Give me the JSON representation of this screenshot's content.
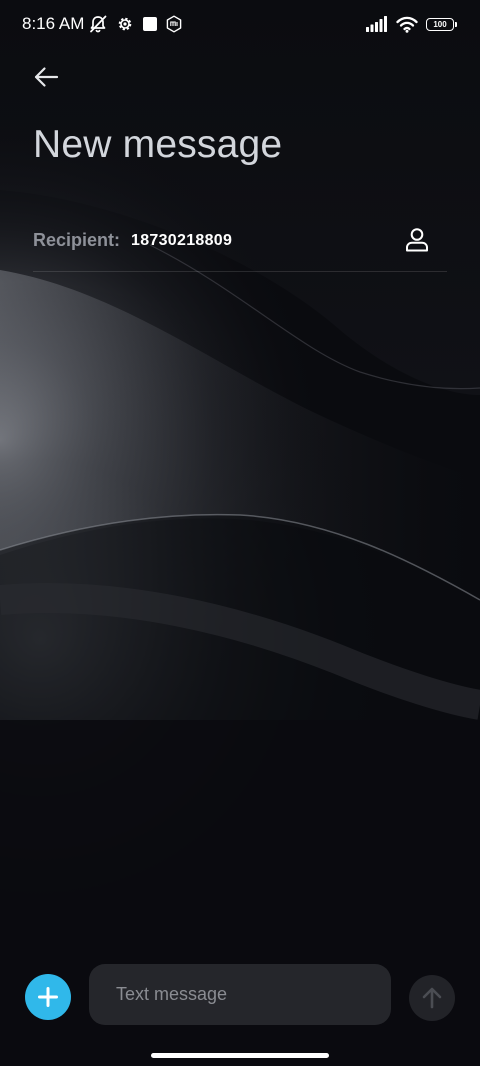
{
  "status_bar": {
    "time": "8:16 AM",
    "battery_level": "100",
    "icons": [
      "mute-notifications-icon",
      "settings-icon",
      "square-notification-icon",
      "mi-icon",
      "signal-icon",
      "wifi-icon",
      "battery-icon"
    ]
  },
  "header": {
    "back_icon": "arrow-left-icon",
    "title": "New message"
  },
  "recipient": {
    "label": "Recipient:",
    "value": "18730218809",
    "contact_icon": "person-icon"
  },
  "composer": {
    "attach_icon": "plus-icon",
    "placeholder": "Text message",
    "value": "",
    "send_icon": "arrow-up-icon"
  },
  "colors": {
    "accent": "#30b8ea",
    "background": "#0a0b0f",
    "input_background": "#25262b",
    "title_text": "#d3d6dc",
    "label_text": "#8e9199"
  }
}
